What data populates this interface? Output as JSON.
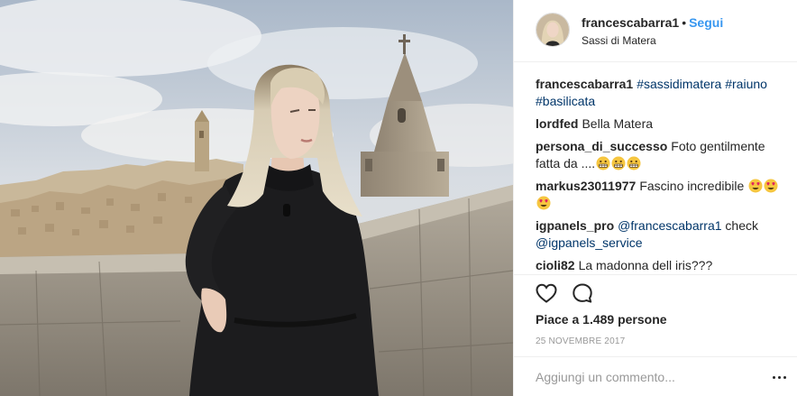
{
  "header": {
    "username": "francescabarra1",
    "separator": "•",
    "follow_label": "Segui",
    "location": "Sassi di Matera"
  },
  "caption": {
    "username": "francescabarra1",
    "tags": [
      "#sassidimatera",
      "#raiuno",
      "#basilicata"
    ]
  },
  "comments": [
    {
      "user": "lordfed",
      "text": "Bella Matera"
    },
    {
      "user": "persona_di_successo",
      "text": "Foto gentilmente fatta da ....",
      "emoji": [
        "grimacing-face",
        "grimacing-face",
        "grimacing-face"
      ]
    },
    {
      "user": "markus23011977",
      "text": "Fascino incredibile",
      "emoji": [
        "heart-eyes-face",
        "heart-eyes-face",
        "heart-eyes-face"
      ]
    },
    {
      "user": "igpanels_pro",
      "mention": "@francescabarra1",
      "text": "check",
      "mention2": "@igpanels_service"
    },
    {
      "user": "cioli82",
      "text": "La madonna dell iris???"
    }
  ],
  "actions": {
    "like_icon": "heart-icon",
    "comment_icon": "comment-bubble-icon"
  },
  "likes": {
    "prefix": "Piace a",
    "count": "1.489",
    "suffix": "persone"
  },
  "date": "25 NOVEMBRE 2017",
  "add_comment": {
    "placeholder": "Aggiungi un commento..."
  },
  "colors": {
    "accent": "#3897f0",
    "hashtag": "#003569",
    "muted": "#999999",
    "text": "#262626"
  }
}
